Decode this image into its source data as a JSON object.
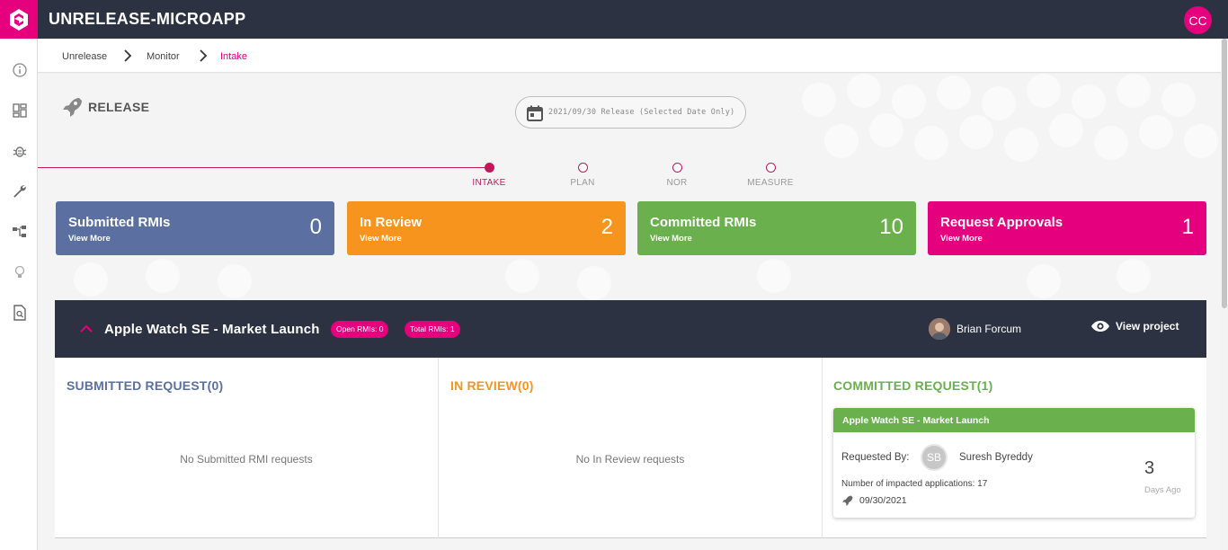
{
  "app": {
    "title": "UNRELEASE-MICROAPP",
    "user_initials": "CC",
    "brand_color": "#e5007d",
    "header_color": "#2d3243"
  },
  "sidebar": {
    "items": [
      {
        "icon": "info-icon"
      },
      {
        "icon": "dashboard-icon"
      },
      {
        "icon": "bug-icon"
      },
      {
        "icon": "wrench-icon"
      },
      {
        "icon": "hierarchy-icon"
      },
      {
        "icon": "lightbulb-icon"
      },
      {
        "icon": "document-search-icon"
      }
    ]
  },
  "breadcrumb": {
    "items": [
      "Unrelease",
      "Monitor",
      "Intake"
    ]
  },
  "release": {
    "label": "RELEASE",
    "date_filter": "2021/09/30 Release (Selected Date Only)"
  },
  "stepper": {
    "steps": [
      "INTAKE",
      "PLAN",
      "NOR",
      "MEASURE"
    ],
    "active": "INTAKE"
  },
  "stats": [
    {
      "title": "Submitted RMIs",
      "link": "View More",
      "value": "0",
      "color": "#5b6fa0"
    },
    {
      "title": "In Review",
      "link": "View More",
      "value": "2",
      "color": "#f7941d"
    },
    {
      "title": "Committed RMIs",
      "link": "View More",
      "value": "10",
      "color": "#6ab04c"
    },
    {
      "title": "Request Approvals",
      "link": "View More",
      "value": "1",
      "color": "#e5007d"
    }
  ],
  "project": {
    "title": "Apple Watch SE - Market Launch",
    "open_rmis": "Open RMIs: 0",
    "total_rmis": "Total RMIs: 1",
    "owner": "Brian Forcum",
    "view_label": "View project",
    "columns": {
      "submitted": {
        "title": "SUBMITTED REQUEST(0)",
        "empty": "No Submitted RMI requests",
        "color": "#5b6fa0"
      },
      "review": {
        "title": "IN REVIEW(0)",
        "empty": "No In Review requests",
        "color": "#f7941d"
      },
      "committed": {
        "title": "COMMITTED REQUEST(1)",
        "color": "#6ab04c"
      }
    },
    "committed_card": {
      "title": "Apple Watch SE - Market Launch",
      "requested_by_label": "Requested By:",
      "requester_initials": "SB",
      "requester_name": "Suresh Byreddy",
      "impacted": "Number of impacted applications: 17",
      "date": "09/30/2021",
      "days_value": "3",
      "days_label": "Days Ago"
    }
  }
}
